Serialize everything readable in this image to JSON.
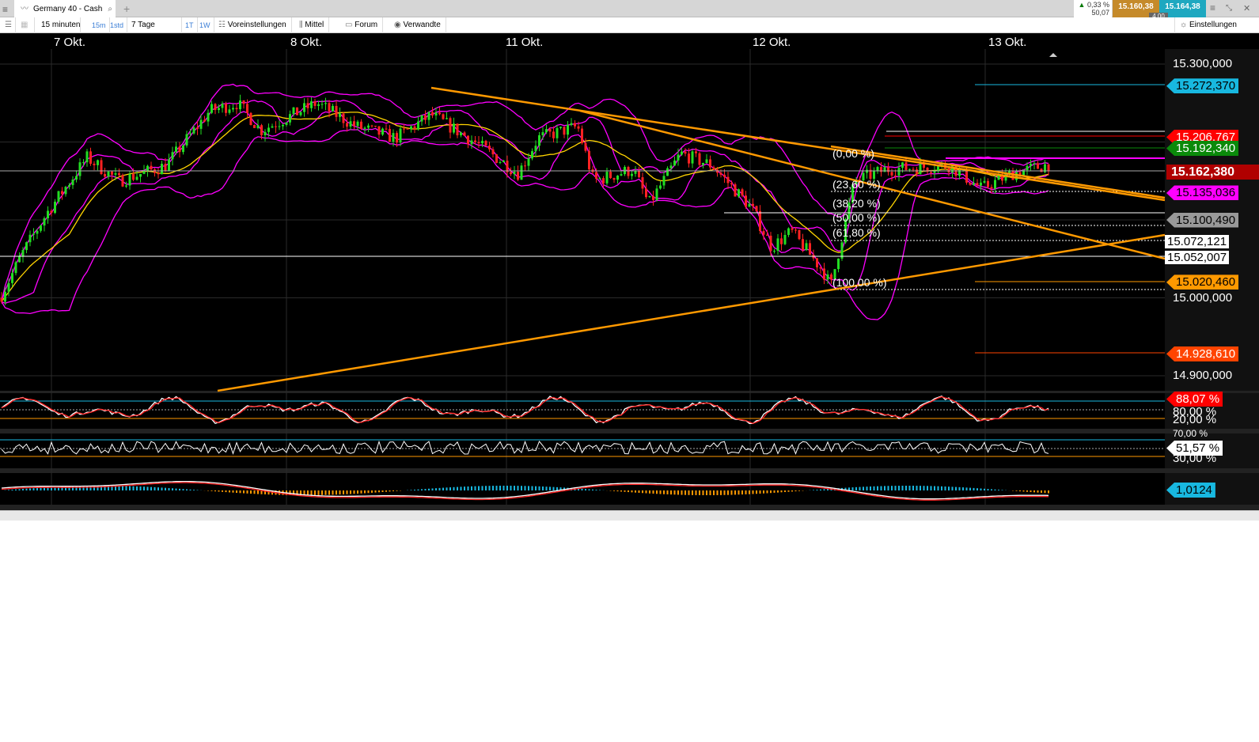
{
  "tab": {
    "title": "Germany 40 - Cash",
    "add": "+"
  },
  "toolbar": {
    "interval": "15 minuten",
    "btn_15m": "15m",
    "btn_1std": "1std",
    "range": "7 Tage",
    "btn_1t": "1T",
    "btn_1w": "1W",
    "presets": "Voreinstellungen",
    "mittel": "Mittel",
    "forum": "Forum",
    "related": "Verwandte",
    "settings": "Einstellungen"
  },
  "quote": {
    "change": "0,33 %",
    "change_abs": "50,07",
    "bid": "15.160,38",
    "ask": "15.164,38",
    "spread": "4,00",
    "bid_color": "#c58a2a",
    "ask_color": "#1ea8c0"
  },
  "dates": [
    "7 Okt.",
    "8 Okt.",
    "11 Okt.",
    "12 Okt.",
    "13 Okt."
  ],
  "axis_labels": [
    {
      "v": 15300,
      "t": "15.300,000"
    },
    {
      "v": 15000,
      "t": "15.000,000"
    },
    {
      "v": 14900,
      "t": "14.900,000"
    }
  ],
  "price_tags": [
    {
      "v": 15272.37,
      "t": "15.272,370",
      "bg": "#18b8e0",
      "fg": "#000"
    },
    {
      "v": 15206.767,
      "t": "15.206,767",
      "bg": "#ff0000",
      "fg": "#fff"
    },
    {
      "v": 15192.34,
      "t": "15.192,340",
      "bg": "#0a8a0a",
      "fg": "#fff"
    },
    {
      "v": 15162.38,
      "t": "15.162,380",
      "bg": "#b00000",
      "fg": "#fff"
    },
    {
      "v": 15135.036,
      "t": "15.135,036",
      "bg": "#ff00ff",
      "fg": "#000"
    },
    {
      "v": 15100.49,
      "t": "15.100,490",
      "bg": "#999999",
      "fg": "#000"
    },
    {
      "v": 15020.46,
      "t": "15.020,460",
      "bg": "#ff9900",
      "fg": "#000"
    },
    {
      "v": 14928.61,
      "t": "14.928,610",
      "bg": "#ff4400",
      "fg": "#fff"
    }
  ],
  "price_boxes": [
    {
      "v": 15072.121,
      "t": "15.072,121"
    },
    {
      "v": 15052.007,
      "t": "15.052,007"
    }
  ],
  "fib_labels": [
    "(0,00 %)",
    "(23,60 %)",
    "(38,20 %)",
    "(50,00 %)",
    "(61,80 %)",
    "(100,00 %)"
  ],
  "stoch": {
    "value": "88,07 %",
    "upper": "80,00 %",
    "lower": "20,00 %"
  },
  "rsi": {
    "value": "51,57 %",
    "upper": "70,00 %",
    "lower": "30,00 %"
  },
  "macd": {
    "value": "1,0124"
  }
}
